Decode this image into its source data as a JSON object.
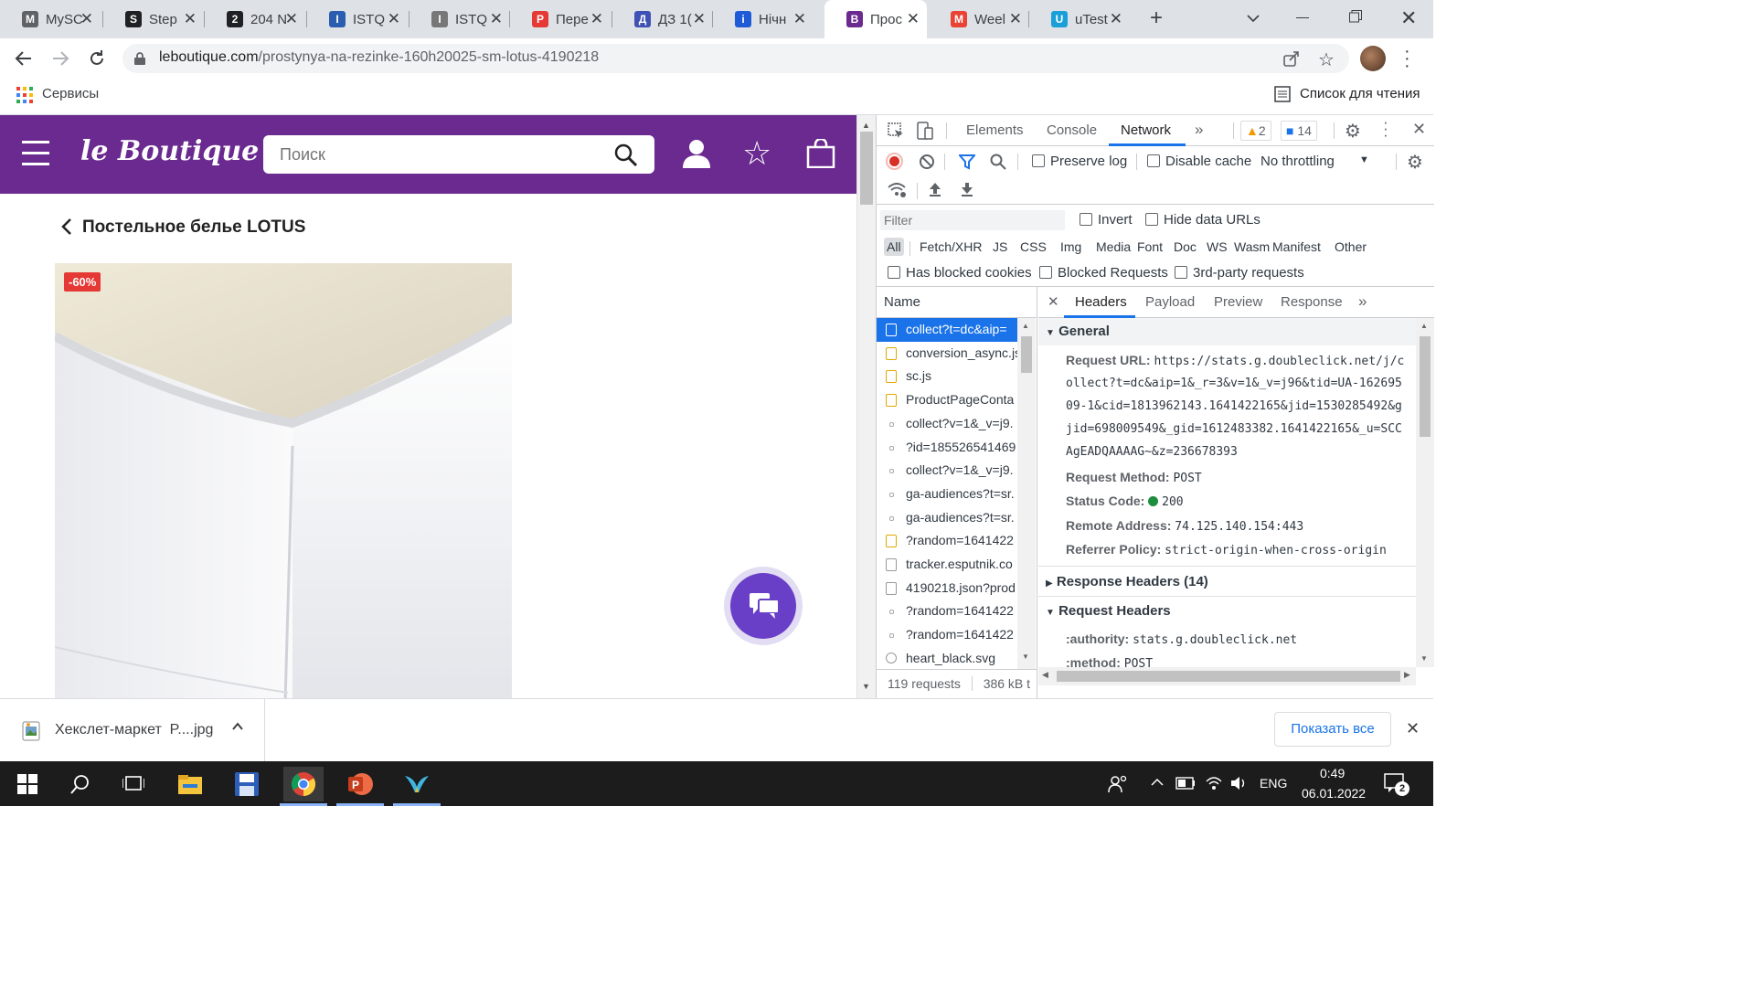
{
  "browser": {
    "tabs": [
      {
        "title": "MySC",
        "color": "#5f6368",
        "letter": "M"
      },
      {
        "title": "Step",
        "color": "#202124",
        "letter": "S"
      },
      {
        "title": "204 N",
        "color": "#202124",
        "letter": "2"
      },
      {
        "title": "ISTQ",
        "color": "#2a5db0",
        "letter": "I"
      },
      {
        "title": "ISTQ",
        "color": "#777777",
        "letter": "I"
      },
      {
        "title": "Пере",
        "color": "#e53935",
        "letter": "P"
      },
      {
        "title": "ДЗ 1(",
        "color": "#3f51b5",
        "letter": "Д"
      },
      {
        "title": "Нічн",
        "color": "#1e5bd7",
        "letter": "i"
      },
      {
        "title": "Прос",
        "color": "#6a2a8f",
        "letter": "B",
        "active": true
      },
      {
        "title": "Weel",
        "color": "#ea4335",
        "letter": "M"
      },
      {
        "title": "uTest",
        "color": "#1a9fd9",
        "letter": "U"
      }
    ],
    "url_domain": "leboutique.com",
    "url_path": "/prostynya-na-rezinke-160h20025-sm-lotus-4190218",
    "bookmarks_apps": "Сервисы",
    "reading_list": "Список для чтения"
  },
  "site": {
    "logo": "le Boutique",
    "search_placeholder": "Поиск",
    "breadcrumb": "Постельное белье LOTUS",
    "discount": "-60%"
  },
  "devtools": {
    "tabs": [
      "Elements",
      "Console",
      "Network"
    ],
    "warnings": "2",
    "messages": "14",
    "preserve_log": "Preserve log",
    "disable_cache": "Disable cache",
    "throttling": "No throttling",
    "filter_placeholder": "Filter",
    "invert": "Invert",
    "hide_data_urls": "Hide data URLs",
    "types": [
      "All",
      "Fetch/XHR",
      "JS",
      "CSS",
      "Img",
      "Media",
      "Font",
      "Doc",
      "WS",
      "Wasm",
      "Manifest",
      "Other"
    ],
    "has_blocked_cookies": "Has blocked cookies",
    "blocked_requests": "Blocked Requests",
    "third_party": "3rd-party requests",
    "name_col": "Name",
    "requests": [
      {
        "name": "collect?t=dc&aip=",
        "icon": "doc",
        "selected": true
      },
      {
        "name": "conversion_async.js",
        "icon": "js"
      },
      {
        "name": "sc.js",
        "icon": "js"
      },
      {
        "name": "ProductPageConta",
        "icon": "js"
      },
      {
        "name": "collect?v=1&_v=j9.",
        "icon": "dot"
      },
      {
        "name": "?id=185526541469",
        "icon": "dot"
      },
      {
        "name": "collect?v=1&_v=j9.",
        "icon": "dot"
      },
      {
        "name": "ga-audiences?t=sr.",
        "icon": "dot"
      },
      {
        "name": "ga-audiences?t=sr.",
        "icon": "dot"
      },
      {
        "name": "?random=1641422",
        "icon": "js"
      },
      {
        "name": "tracker.esputnik.co",
        "icon": "doc"
      },
      {
        "name": "4190218.json?prod",
        "icon": "doc"
      },
      {
        "name": "?random=1641422",
        "icon": "dot"
      },
      {
        "name": "?random=1641422",
        "icon": "dot"
      },
      {
        "name": "heart_black.svg",
        "icon": "svg"
      }
    ],
    "summary_requests": "119 requests",
    "summary_size": "386 kB t",
    "detail_tabs": [
      "Headers",
      "Payload",
      "Preview",
      "Response"
    ],
    "general_title": "General",
    "request_url_label": "Request URL:",
    "request_url_lines": [
      "https://stats.g.doubleclick.net/j/c",
      "ollect?t=dc&aip=1&_r=3&v=1&_v=j96&tid=UA-162695",
      "09-1&cid=1813962143.1641422165&jid=1530285492&g",
      "jid=698009549&_gid=1612483382.1641422165&_u=SCC",
      "AgEADQAAAAG~&z=236678393"
    ],
    "request_method_label": "Request Method:",
    "request_method": "POST",
    "status_code_label": "Status Code:",
    "status_code": "200",
    "remote_address_label": "Remote Address:",
    "remote_address": "74.125.140.154:443",
    "referrer_policy_label": "Referrer Policy:",
    "referrer_policy": "strict-origin-when-cross-origin",
    "response_headers": "Response Headers (14)",
    "request_headers": "Request Headers",
    "authority_label": ":authority:",
    "authority": "stats.g.doubleclick.net",
    "method_label": ":method:",
    "method": "POST"
  },
  "download": {
    "file": "Хекслет-маркет  P....jpg",
    "show_all": "Показать все"
  },
  "taskbar": {
    "lang": "ENG",
    "time": "0:49",
    "date": "06.01.2022",
    "notifications": "2"
  }
}
